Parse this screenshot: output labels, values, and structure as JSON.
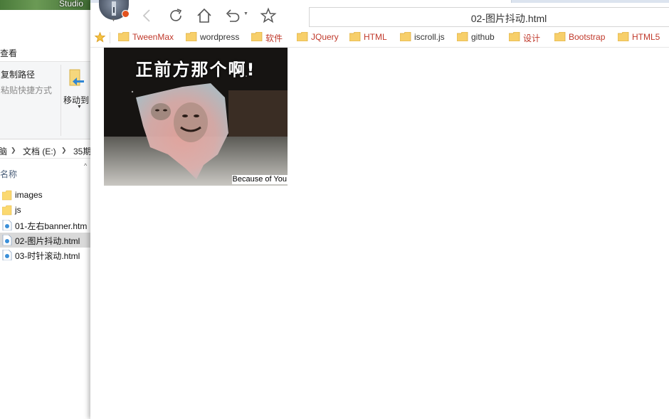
{
  "explorer": {
    "desktop_label": "Studio",
    "menu_view": "查看",
    "ribbon": {
      "copy_path": "复制路径",
      "paste_shortcut": "粘贴快捷方式",
      "move_to": "移动到"
    },
    "breadcrumb": [
      "脑",
      "文档 (E:)",
      "35期"
    ],
    "column_name": "名称",
    "files": [
      {
        "name": "images",
        "type": "folder",
        "selected": false
      },
      {
        "name": "js",
        "type": "folder",
        "selected": false
      },
      {
        "name": "01-左右banner.htm",
        "type": "html",
        "selected": false
      },
      {
        "name": "02-图片抖动.html",
        "type": "html",
        "selected": true
      },
      {
        "name": "03-时针滚动.html",
        "type": "html",
        "selected": false
      }
    ]
  },
  "browser": {
    "url": "02-图片抖动.html",
    "bookmarks": [
      {
        "label": "TweenMax",
        "color": "#c0392b"
      },
      {
        "label": "wordpress",
        "color": "#333333"
      },
      {
        "label": "软件",
        "color": "#c0392b"
      },
      {
        "label": "JQuery",
        "color": "#c0392b"
      },
      {
        "label": "HTML",
        "color": "#c0392b"
      },
      {
        "label": "iscroll.js",
        "color": "#333333"
      },
      {
        "label": "github",
        "color": "#333333"
      },
      {
        "label": "设计",
        "color": "#c0392b"
      },
      {
        "label": "Bootstrap",
        "color": "#c0392b"
      },
      {
        "label": "HTML5",
        "color": "#c0392b"
      }
    ],
    "meme": {
      "caption": "正前方那个啊!",
      "watermark": "Because of You"
    }
  }
}
